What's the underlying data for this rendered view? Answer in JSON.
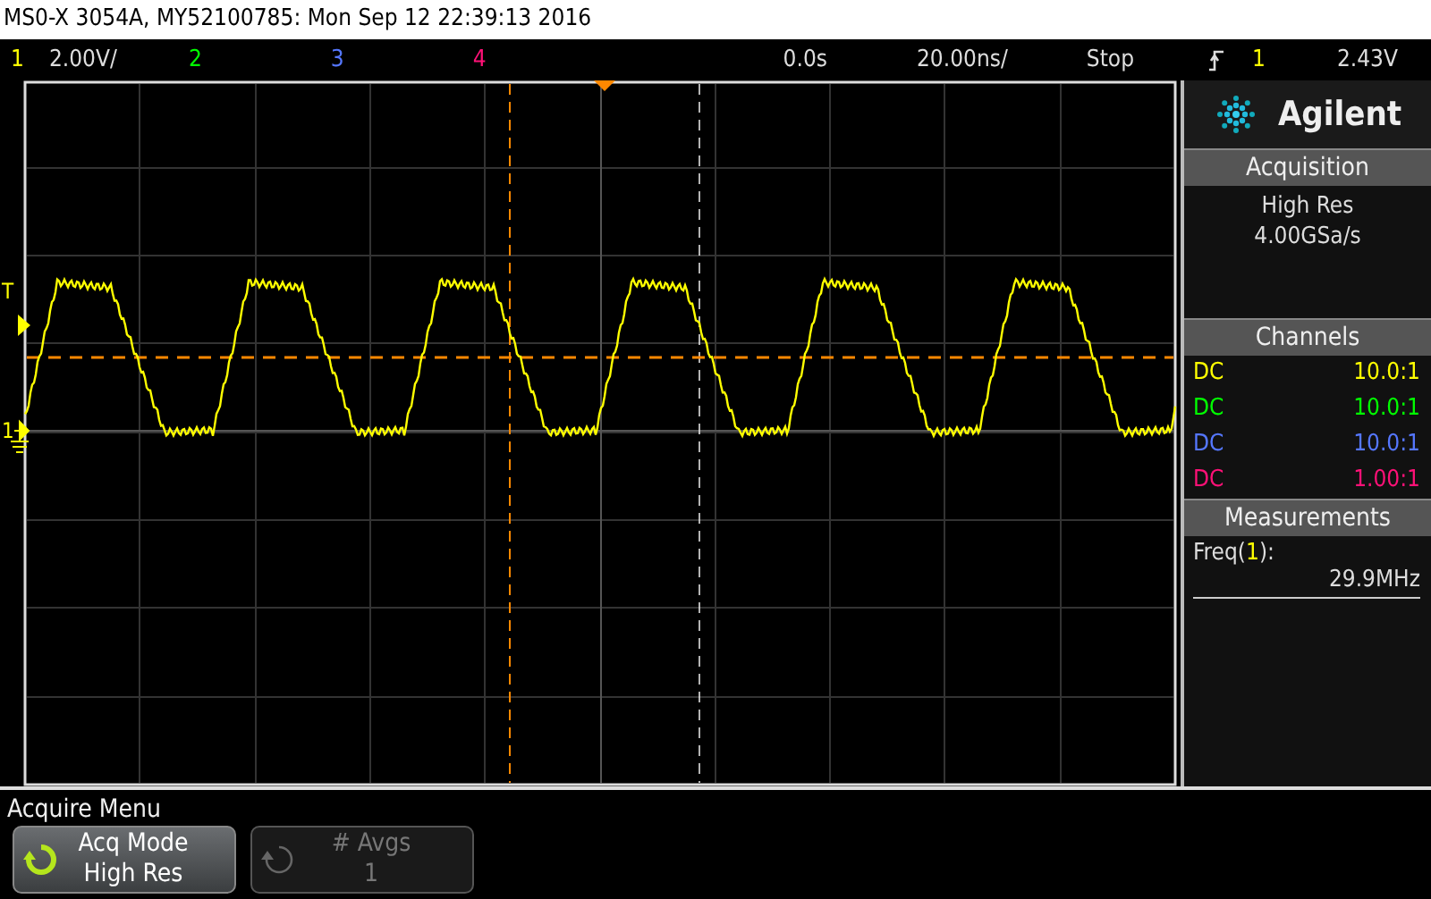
{
  "title_bar": {
    "title": "MS0-X 3054A, MY52100785: Mon Sep 12 22:39:13 2016"
  },
  "status_bar": {
    "channels": [
      {
        "label": "1",
        "scale": "2.00V/",
        "color": "#ffff00"
      },
      {
        "label": "2",
        "color": "#00ff00"
      },
      {
        "label": "3",
        "color": "#5577ff"
      },
      {
        "label": "4",
        "color": "#ff1177"
      }
    ],
    "delay": "0.0s",
    "timebase": "20.00ns/",
    "run_state": "Stop",
    "trigger_source": "1",
    "trigger_level": "2.43V"
  },
  "display": {
    "trigger_marker": "T",
    "channel_marker": "1"
  },
  "side_panel": {
    "brand": "Agilent",
    "acquisition": {
      "title": "Acquisition",
      "mode": "High Res",
      "sample_rate": "4.00GSa/s"
    },
    "channels": {
      "title": "Channels",
      "items": [
        {
          "coupling": "DC",
          "probe": "10.0:1",
          "color": "#ffff00"
        },
        {
          "coupling": "DC",
          "probe": "10.0:1",
          "color": "#00ff00"
        },
        {
          "coupling": "DC",
          "probe": "10.0:1",
          "color": "#5577ff"
        },
        {
          "coupling": "DC",
          "probe": "1.00:1",
          "color": "#ff1177"
        }
      ]
    },
    "measurements": {
      "title": "Measurements",
      "items": [
        {
          "name_before": "Freq(",
          "source": "1",
          "name_after": "):",
          "value": "29.9MHz",
          "color": "#ffff00"
        }
      ]
    }
  },
  "menu": {
    "title": "Acquire Menu",
    "softkeys": [
      {
        "label": "Acq Mode",
        "value": "High Res",
        "disabled": false
      },
      {
        "label": "# Avgs",
        "value": "1",
        "disabled": true
      }
    ]
  }
}
